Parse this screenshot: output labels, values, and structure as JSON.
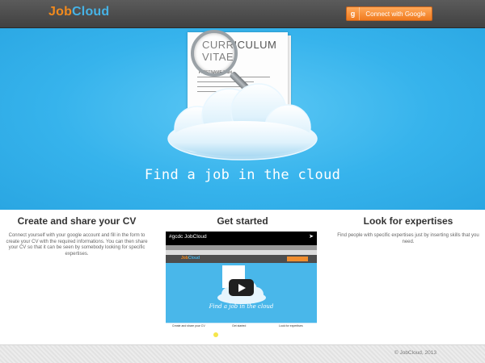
{
  "header": {
    "logo_job": "Job",
    "logo_cloud": "Cloud",
    "connect_button": {
      "icon": "google-plus-icon",
      "icon_glyph": "g",
      "label": "Connect with Google"
    }
  },
  "hero": {
    "cv_line1": "CURRICULUM",
    "cv_line2": "VITAE",
    "cv_name": "FIRSTNAME Maxi...",
    "tagline": "Find a job in the cloud"
  },
  "columns": [
    {
      "title": "Create and share your CV",
      "text": "Connect yourself with your google account and fill in the form to create your CV with the required informations. You can then share your CV so that it can be seen by somebody looking for specific expertises."
    },
    {
      "title": "Get started",
      "video": {
        "title": "#gcdc JobCloud",
        "share_icon": "share-icon",
        "mini_logo_job": "Job",
        "mini_logo_cloud": "Cloud",
        "mini_tagline": "Find a job in the cloud",
        "mini_col1": "Create and share your CV",
        "mini_col2": "Get started",
        "mini_col3": "Look for expertises",
        "play_icon": "play-icon"
      }
    },
    {
      "title": "Look for expertises",
      "text": "Find people with specific expertises just by inserting skills that you need."
    }
  ],
  "footer": {
    "copyright": "© JobCloud, 2013"
  },
  "colors": {
    "orange": "#f28a1d",
    "blue": "#46b3e6",
    "hero_bg": "#36b3ec",
    "header_bg": "#4a4a4a"
  }
}
